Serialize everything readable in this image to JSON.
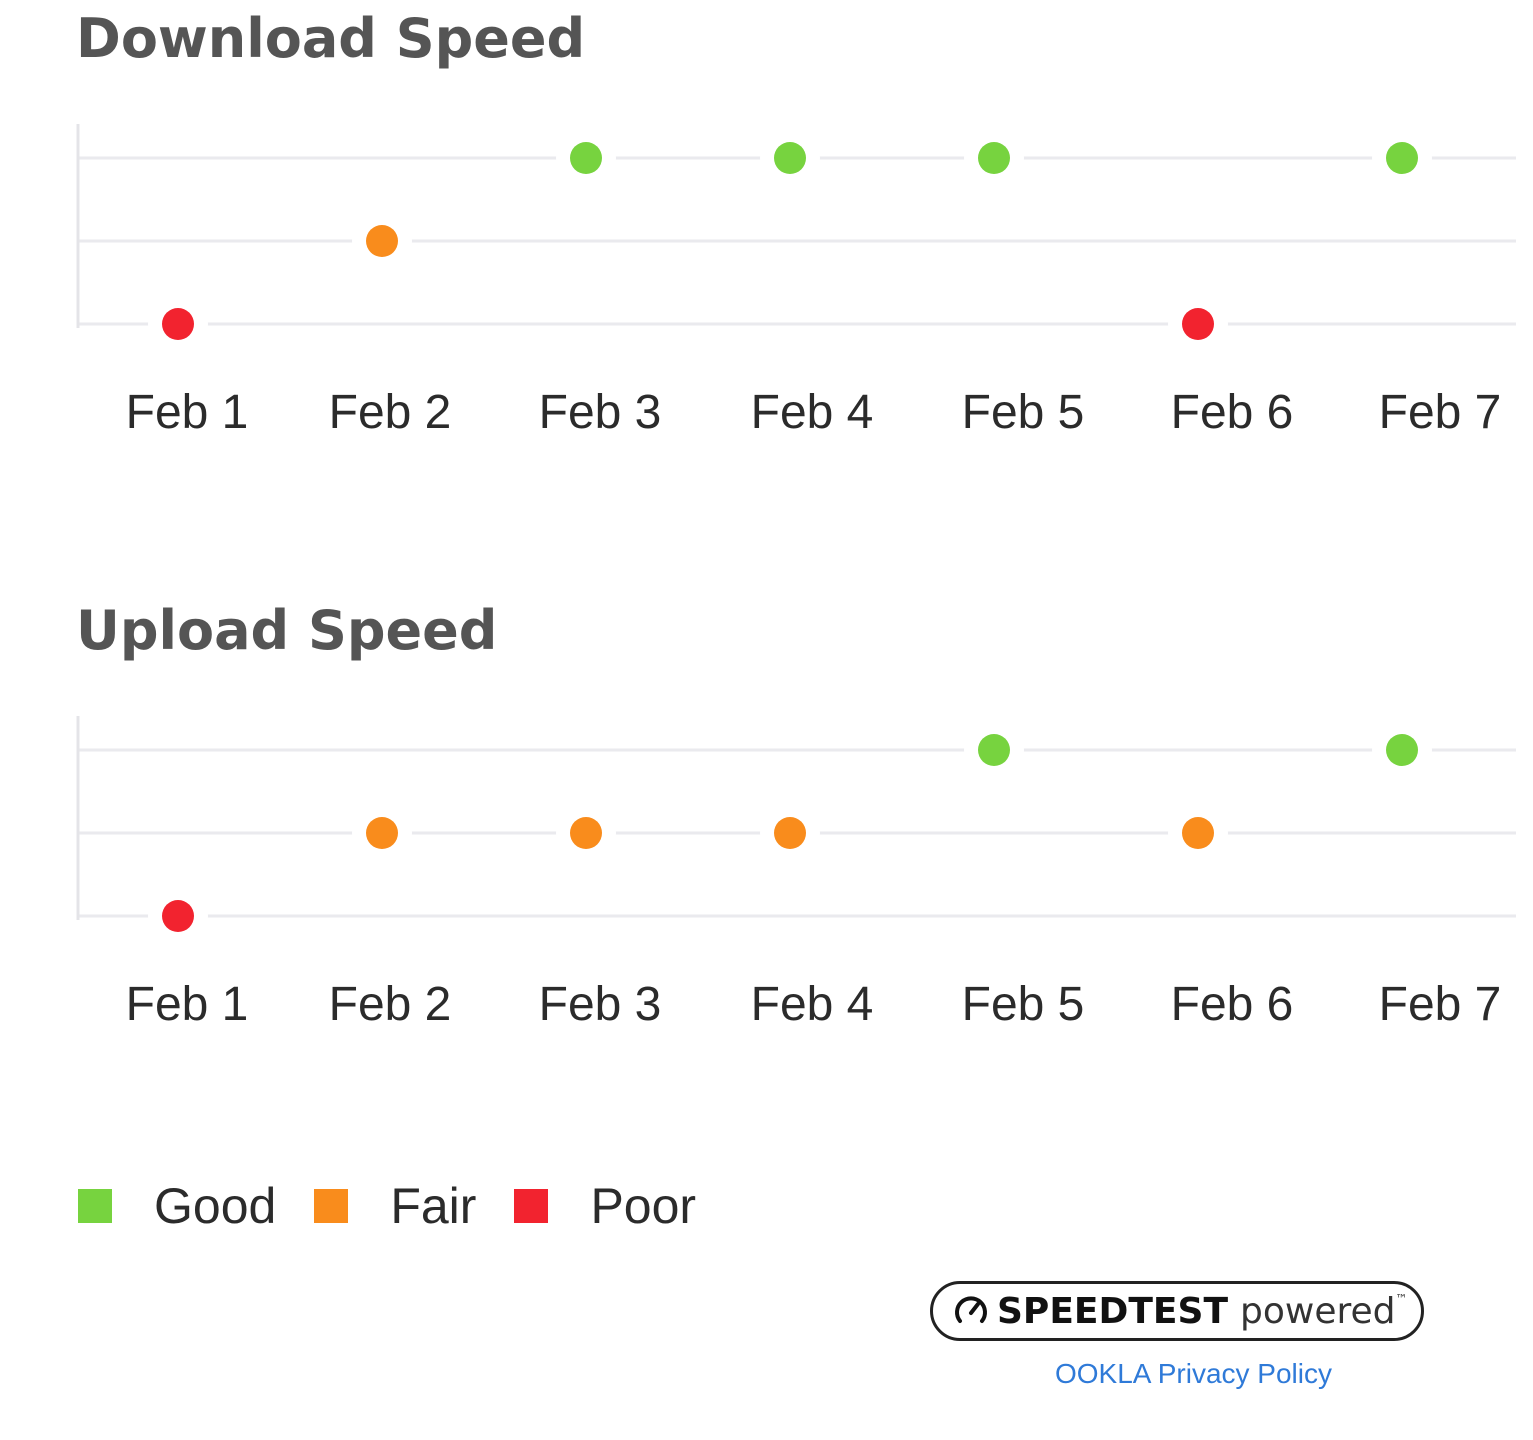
{
  "colors": {
    "good": "#77d33f",
    "fair": "#f98c1c",
    "poor": "#f2232f",
    "grid": "#eaeaee",
    "axis": "#e4e4e8"
  },
  "chart_data": [
    {
      "type": "scatter",
      "title": "Download Speed",
      "categories": [
        "Feb 1",
        "Feb 2",
        "Feb 3",
        "Feb 4",
        "Feb 5",
        "Feb 6",
        "Feb 7"
      ],
      "levels": [
        "Poor",
        "Fair",
        "Good"
      ],
      "values": [
        "Poor",
        "Fair",
        "Good",
        "Good",
        "Good",
        "Poor",
        "Good"
      ],
      "grid": true
    },
    {
      "type": "scatter",
      "title": "Upload Speed",
      "categories": [
        "Feb 1",
        "Feb 2",
        "Feb 3",
        "Feb 4",
        "Feb 5",
        "Feb 6",
        "Feb 7"
      ],
      "levels": [
        "Poor",
        "Fair",
        "Good"
      ],
      "values": [
        "Poor",
        "Fair",
        "Fair",
        "Fair",
        "Good",
        "Fair",
        "Good"
      ],
      "grid": true
    }
  ],
  "legend": {
    "placement": "bottom-left",
    "items": [
      {
        "label": "Good",
        "key": "good"
      },
      {
        "label": "Fair",
        "key": "fair"
      },
      {
        "label": "Poor",
        "key": "poor"
      }
    ]
  },
  "footer": {
    "badge_brand": "SPEEDTEST",
    "badge_powered": "powered",
    "badge_tm": "™",
    "gauge_icon": "speedometer-icon",
    "privacy_link": "OOKLA Privacy Policy"
  }
}
